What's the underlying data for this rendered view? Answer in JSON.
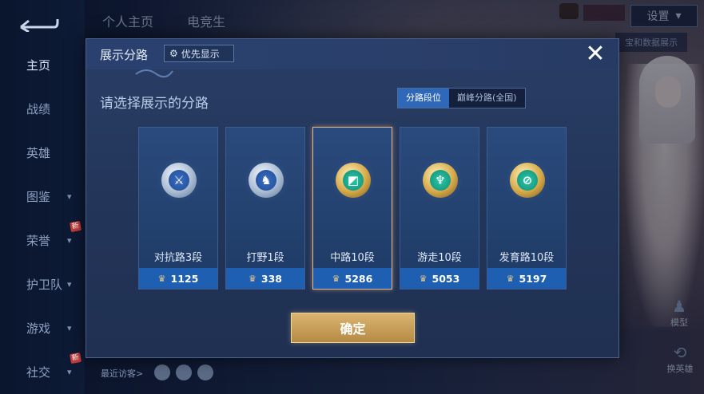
{
  "nav": {
    "items": [
      {
        "label": "主页",
        "chevron": false,
        "active": true,
        "new": false
      },
      {
        "label": "战绩",
        "chevron": false,
        "active": false,
        "new": false
      },
      {
        "label": "英雄",
        "chevron": false,
        "active": false,
        "new": false
      },
      {
        "label": "图鉴",
        "chevron": true,
        "active": false,
        "new": false
      },
      {
        "label": "荣誉",
        "chevron": true,
        "active": false,
        "new": true
      },
      {
        "label": "护卫队",
        "chevron": true,
        "active": false,
        "new": false
      },
      {
        "label": "游戏",
        "chevron": true,
        "active": false,
        "new": false
      },
      {
        "label": "社交",
        "chevron": true,
        "active": false,
        "new": true
      }
    ],
    "new_tag": "新"
  },
  "topbar": {
    "tab1": "个人主页",
    "tab2": "电竞生",
    "settings": "设置",
    "data_btn": "宝和数据展示"
  },
  "modal": {
    "title": "展示分路",
    "priority_label": "优先显示",
    "close": "✕",
    "subtitle": "请选择展示的分路",
    "tabs": [
      {
        "label": "分路段位",
        "active": true
      },
      {
        "label": "巅峰分路(全国)",
        "active": false
      }
    ],
    "lanes": [
      {
        "rank": "对抗路3段",
        "score": "1125",
        "badge": "silver",
        "glyph": "⚔",
        "selected": false
      },
      {
        "rank": "打野1段",
        "score": "338",
        "badge": "silver",
        "glyph": "♞",
        "selected": false
      },
      {
        "rank": "中路10段",
        "score": "5286",
        "badge": "gold",
        "glyph": "◩",
        "selected": true
      },
      {
        "rank": "游走10段",
        "score": "5053",
        "badge": "gold",
        "glyph": "♆",
        "selected": false
      },
      {
        "rank": "发育路10段",
        "score": "5197",
        "badge": "gold",
        "glyph": "⊘",
        "selected": false
      }
    ],
    "confirm": "确定"
  },
  "right": {
    "model": "模型",
    "swap": "换英雄"
  },
  "footer": {
    "visitors": "最近访客>"
  }
}
